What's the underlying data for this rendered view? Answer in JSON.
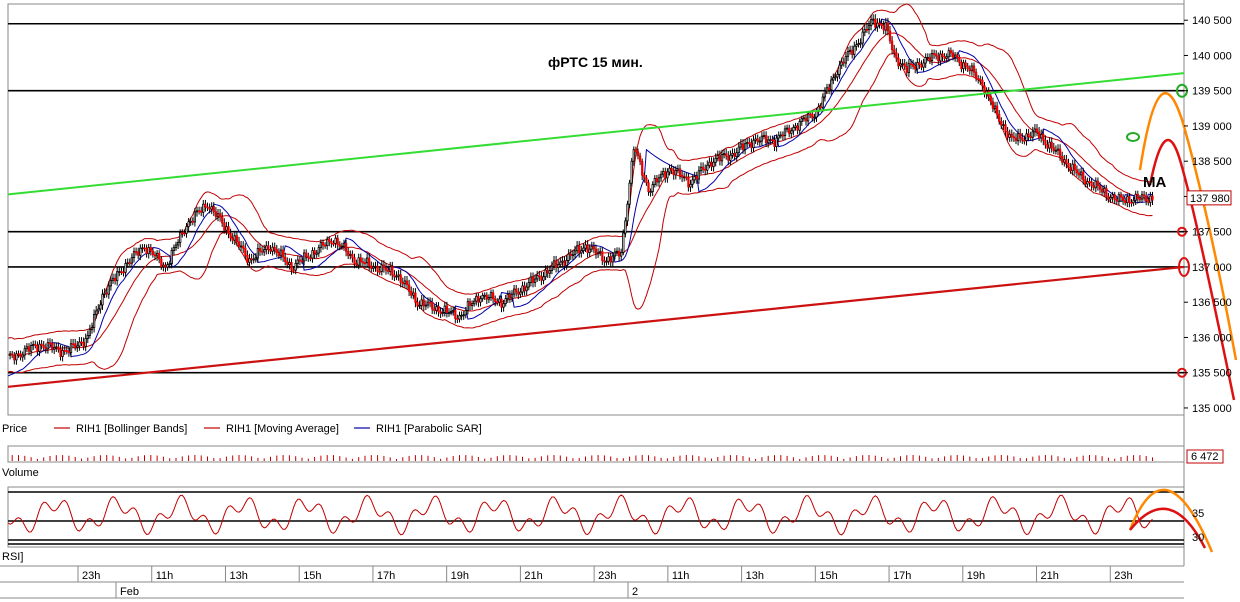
{
  "chart_data": {
    "type": "candlestick",
    "title": "фРТС   15 мин.",
    "annotation": "MA",
    "price_axis": {
      "ylim": [
        134900,
        140730
      ],
      "ticks": [
        "140 500",
        "140 000",
        "139 500",
        "139 000",
        "138 500",
        "138 000",
        "137 500",
        "137 000",
        "136 500",
        "136 000",
        "135 500",
        "135 000"
      ],
      "tick_values": [
        140500,
        140000,
        139500,
        139000,
        138500,
        138000,
        137500,
        137000,
        136500,
        136000,
        135500,
        135000
      ],
      "last_price_label": "137 980",
      "last_price": 137980
    },
    "horizontal_levels": [
      140450,
      139500,
      137500,
      137000,
      135500
    ],
    "volume_label": "6 472",
    "rsi_ticks": [
      "35",
      "30"
    ],
    "x_ticks": [
      "23h",
      "11h",
      "13h",
      "15h",
      "17h",
      "19h",
      "21h",
      "23h",
      "11h",
      "13h",
      "15h",
      "17h",
      "19h",
      "21h",
      "23h"
    ],
    "date_labels": [
      "Feb",
      "2"
    ],
    "legend": [
      {
        "label": "Price",
        "color": "#000000"
      },
      {
        "label": "RIH1 [Bollinger Bands]",
        "color": "#c00000"
      },
      {
        "label": "RIH1 [Moving Average]",
        "color": "#c00000"
      },
      {
        "label": "RIH1 [Parabolic SAR]",
        "color": "#0000aa"
      }
    ],
    "panel_labels": {
      "volume": "Volume",
      "rsi": "RSI]"
    },
    "colors": {
      "up_candle": "#ffffff",
      "down_candle": "#ee0000",
      "bollinger": "#c00000",
      "moving_average": "#c00000",
      "sar": "#0000aa",
      "green_trend": "#33dd33",
      "red_trend": "#cc1111",
      "forecast_orange": "#ff8800",
      "forecast_red": "#dd1111"
    },
    "price_anchors": [
      [
        0,
        135700
      ],
      [
        15,
        135900
      ],
      [
        28,
        135800
      ],
      [
        38,
        136000
      ],
      [
        45,
        136600
      ],
      [
        55,
        137000
      ],
      [
        65,
        137300
      ],
      [
        75,
        137000
      ],
      [
        85,
        137600
      ],
      [
        95,
        137900
      ],
      [
        105,
        137500
      ],
      [
        115,
        137100
      ],
      [
        125,
        137300
      ],
      [
        135,
        137000
      ],
      [
        145,
        137200
      ],
      [
        155,
        137400
      ],
      [
        165,
        137100
      ],
      [
        175,
        137000
      ],
      [
        185,
        136900
      ],
      [
        195,
        136500
      ],
      [
        205,
        136400
      ],
      [
        215,
        136300
      ],
      [
        225,
        136600
      ],
      [
        235,
        136500
      ],
      [
        245,
        136700
      ],
      [
        255,
        136900
      ],
      [
        265,
        137100
      ],
      [
        275,
        137300
      ],
      [
        285,
        137100
      ],
      [
        292,
        137200
      ],
      [
        298,
        138700
      ],
      [
        305,
        138100
      ],
      [
        315,
        138400
      ],
      [
        325,
        138200
      ],
      [
        335,
        138500
      ],
      [
        345,
        138600
      ],
      [
        355,
        138800
      ],
      [
        365,
        138800
      ],
      [
        375,
        139000
      ],
      [
        385,
        139200
      ],
      [
        395,
        139800
      ],
      [
        405,
        140200
      ],
      [
        412,
        140500
      ],
      [
        418,
        140400
      ],
      [
        422,
        140000
      ],
      [
        428,
        139800
      ],
      [
        435,
        139900
      ],
      [
        442,
        140000
      ],
      [
        450,
        140000
      ],
      [
        458,
        139800
      ],
      [
        464,
        139600
      ],
      [
        470,
        139200
      ],
      [
        478,
        138800
      ],
      [
        490,
        138900
      ],
      [
        500,
        138600
      ],
      [
        510,
        138300
      ],
      [
        520,
        138100
      ],
      [
        528,
        137950
      ],
      [
        545,
        137980
      ]
    ]
  }
}
